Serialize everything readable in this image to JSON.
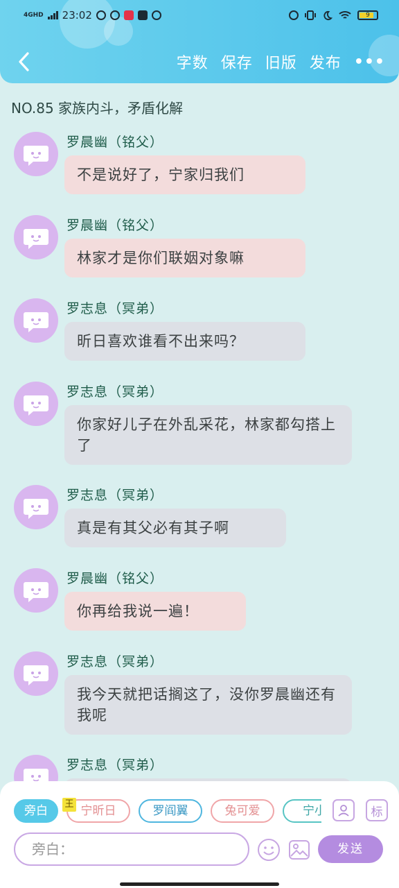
{
  "status_bar": {
    "network": "4GHD",
    "time": "23:02",
    "battery": "9"
  },
  "header": {
    "actions": [
      "字数",
      "保存",
      "旧版",
      "发布"
    ],
    "more": "•••"
  },
  "chapter_title": "NO.85 家族内斗，矛盾化解",
  "messages": [
    {
      "name": "罗晨幽（铭父）",
      "text": "不是说好了，宁家归我们",
      "tone": "pink"
    },
    {
      "name": "罗晨幽（铭父）",
      "text": "林家才是你们联姻对象嘛",
      "tone": "pink"
    },
    {
      "name": "罗志息（冥弟）",
      "text": "昕日喜欢谁看不出来吗？",
      "tone": "grey"
    },
    {
      "name": "罗志息（冥弟）",
      "text": "你家好儿子在外乱采花，林家都勾搭上了",
      "tone": "grey"
    },
    {
      "name": "罗志息（冥弟）",
      "text": "真是有其父必有其子啊",
      "tone": "grey"
    },
    {
      "name": "罗晨幽（铭父）",
      "text": "你再给我说一遍！",
      "tone": "pink"
    },
    {
      "name": "罗志息（冥弟）",
      "text": "我今天就把话搁这了，没你罗晨幽还有我呢",
      "tone": "grey"
    },
    {
      "name": "罗志息（冥弟）",
      "text": "",
      "tone": "grey"
    }
  ],
  "bottom": {
    "chips": [
      "旁白",
      "宁昕日",
      "罗阎翼",
      "兔可爱",
      "宁小"
    ],
    "king_badge": "王",
    "tag_button": "标",
    "input_placeholder": "旁白：",
    "send_label": "发送"
  },
  "colors": {
    "header_start": "#6fd3ee",
    "header_end": "#4cc1ea",
    "background": "#d9efef",
    "bubble_pink": "#f3dcdc",
    "bubble_grey": "#dde0e6",
    "avatar": "#d9b6ef",
    "send": "#b48ce0"
  }
}
